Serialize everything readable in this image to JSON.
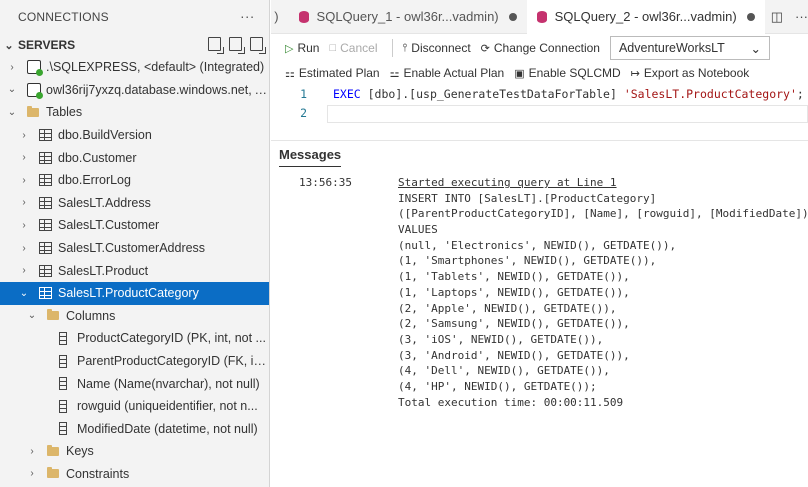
{
  "sidebar": {
    "header": "CONNECTIONS",
    "more": "···",
    "servers_label": "SERVERS",
    "tree": [
      {
        "indent": 0,
        "tw": "›",
        "icon": "server",
        "label": ".\\SQLEXPRESS, <default> (Integrated)"
      },
      {
        "indent": 0,
        "tw": "⌄",
        "icon": "server",
        "label": "owl36rij7yxzq.database.windows.net, A..."
      },
      {
        "indent": 1,
        "tw": "⌄",
        "icon": "folder",
        "label": "Tables"
      },
      {
        "indent": 2,
        "tw": "›",
        "icon": "table",
        "label": "dbo.BuildVersion"
      },
      {
        "indent": 2,
        "tw": "›",
        "icon": "table",
        "label": "dbo.Customer"
      },
      {
        "indent": 2,
        "tw": "›",
        "icon": "table",
        "label": "dbo.ErrorLog"
      },
      {
        "indent": 2,
        "tw": "›",
        "icon": "table",
        "label": "SalesLT.Address"
      },
      {
        "indent": 2,
        "tw": "›",
        "icon": "table",
        "label": "SalesLT.Customer"
      },
      {
        "indent": 2,
        "tw": "›",
        "icon": "table",
        "label": "SalesLT.CustomerAddress"
      },
      {
        "indent": 2,
        "tw": "›",
        "icon": "table",
        "label": "SalesLT.Product"
      },
      {
        "indent": 2,
        "tw": "⌄",
        "icon": "table",
        "label": "SalesLT.ProductCategory",
        "selected": true
      },
      {
        "indent": 3,
        "tw": "⌄",
        "icon": "folder",
        "label": "Columns"
      },
      {
        "indent": 4,
        "tw": "",
        "icon": "column",
        "label": "ProductCategoryID (PK, int, not ..."
      },
      {
        "indent": 4,
        "tw": "",
        "icon": "column",
        "label": "ParentProductCategoryID (FK, in..."
      },
      {
        "indent": 4,
        "tw": "",
        "icon": "column",
        "label": "Name (Name(nvarchar), not null)"
      },
      {
        "indent": 4,
        "tw": "",
        "icon": "column",
        "label": "rowguid (uniqueidentifier, not n..."
      },
      {
        "indent": 4,
        "tw": "",
        "icon": "column",
        "label": "ModifiedDate (datetime, not null)"
      },
      {
        "indent": 3,
        "tw": "›",
        "icon": "folder",
        "label": "Keys"
      },
      {
        "indent": 3,
        "tw": "›",
        "icon": "folder",
        "label": "Constraints"
      }
    ]
  },
  "tabs": {
    "partial": ")",
    "tab1": "SQLQuery_1 - owl36r...vadmin)",
    "tab2": "SQLQuery_2 - owl36r...vadmin)",
    "split_icon": "◫",
    "more": "···"
  },
  "toolbar": {
    "run": "Run",
    "cancel": "Cancel",
    "disconnect": "Disconnect",
    "change_connection": "Change Connection",
    "database": "AdventureWorksLT",
    "estimated_plan": "Estimated Plan",
    "actual_plan": "Enable Actual Plan",
    "sqlcmd": "Enable SQLCMD",
    "export": "Export as Notebook"
  },
  "editor": {
    "line1_no": "1",
    "line2_no": "2",
    "kw_exec": "EXEC",
    "proc": " [dbo].[usp_GenerateTestDataForTable] ",
    "arg": "'SalesLT.ProductCategory'",
    "end": ";"
  },
  "messages": {
    "title": "Messages",
    "time": "13:56:35",
    "lines": [
      "Started executing query at Line 1",
      "INSERT INTO [SalesLT].[ProductCategory]",
      "([ParentProductCategoryID], [Name], [rowguid], [ModifiedDate])",
      "VALUES",
      "(null, 'Electronics', NEWID(), GETDATE()),",
      "(1, 'Smartphones', NEWID(), GETDATE()),",
      "(1, 'Tablets', NEWID(), GETDATE()),",
      "(1, 'Laptops', NEWID(), GETDATE()),",
      "(2, 'Apple', NEWID(), GETDATE()),",
      "(2, 'Samsung', NEWID(), GETDATE()),",
      "(3, 'iOS', NEWID(), GETDATE()),",
      "(3, 'Android', NEWID(), GETDATE()),",
      "(4, 'Dell', NEWID(), GETDATE()),",
      "(4, 'HP', NEWID(), GETDATE());",
      "Total execution time: 00:00:11.509"
    ]
  },
  "colors": {
    "accent": "#0b6dc5",
    "run": "#388a34",
    "db_icon": "#c5326e"
  }
}
